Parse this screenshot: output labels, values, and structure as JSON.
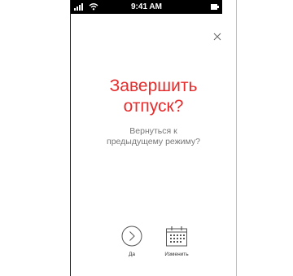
{
  "status_bar": {
    "time": "9:41 AM"
  },
  "dialog": {
    "title_line1": "Завершить",
    "title_line2": "отпуск?",
    "subtitle_line1": "Вернуться к",
    "subtitle_line2": "предыдущему режиму?",
    "close_icon": "close-icon"
  },
  "actions": {
    "yes_label": "Да",
    "yes_icon": "chevron-right-circle-icon",
    "change_label": "Изменить",
    "change_icon": "calendar-icon"
  },
  "colors": {
    "accent": "#e52b2b",
    "text_muted": "#777777",
    "icon": "#555555"
  }
}
